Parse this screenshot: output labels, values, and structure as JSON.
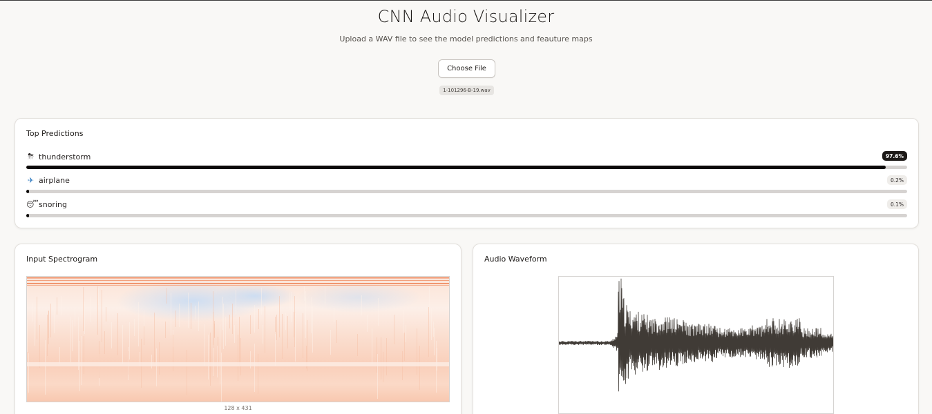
{
  "header": {
    "title": "CNN Audio Visualizer",
    "subtitle": "Upload a WAV file to see the model predictions and feauture maps"
  },
  "upload": {
    "button_label": "Choose File",
    "file_name": "1-101296-B-19.wav"
  },
  "predictions": {
    "title": "Top Predictions",
    "items": [
      {
        "emoji": "⛈",
        "label": "thunderstorm",
        "value": 97.6,
        "display": "97.6%"
      },
      {
        "emoji": "✈",
        "label": "airplane",
        "value": 0.2,
        "display": "0.2%"
      },
      {
        "emoji": "😴",
        "label": "snoring",
        "value": 0.1,
        "display": "0.1%"
      }
    ]
  },
  "spectrogram": {
    "title": "Input Spectrogram",
    "dimensions": "128 x 431"
  },
  "waveform": {
    "title": "Audio Waveform"
  },
  "colors": {
    "accent": "#1c1917",
    "spectrogram_warm": "#f7b89a",
    "spectrogram_cool": "#b9d3f0",
    "waveform": "#403b36"
  }
}
